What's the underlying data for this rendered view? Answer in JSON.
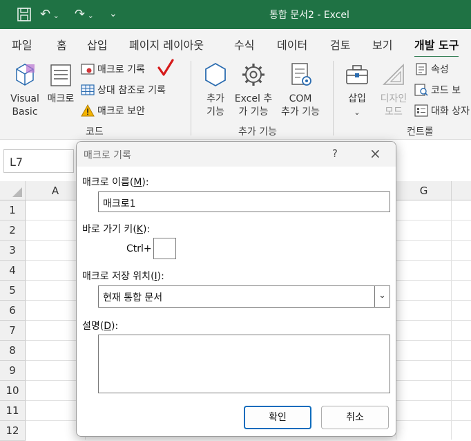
{
  "window": {
    "title": "통합 문서2 - Excel"
  },
  "ribbon_tabs": [
    "파일",
    "홈",
    "삽입",
    "페이지 레이아웃",
    "수식",
    "데이터",
    "검토",
    "보기",
    "개발 도구"
  ],
  "active_tab": "개발 도구",
  "ribbon": {
    "visual_basic": [
      "Visual",
      "Basic"
    ],
    "macros": "매크로",
    "record_macro": "매크로 기록",
    "relative_refs": "상대 참조로 기록",
    "macro_security": "매크로 보안",
    "group_code": "코드",
    "addins": [
      "추가",
      "기능"
    ],
    "excel_addins": [
      "Excel 추",
      "가 기능"
    ],
    "com_addins": [
      "COM",
      "추가 기능"
    ],
    "group_addins": "추가 기능",
    "insert": "삽입",
    "design_mode": [
      "디자인",
      "모드"
    ],
    "properties": "속성",
    "view_code": "코드 보",
    "run_dialog": "대화 상자",
    "group_controls": "컨트롤"
  },
  "name_box": "L7",
  "columns": [
    "A",
    "G"
  ],
  "rows": [
    "1",
    "2",
    "3",
    "4",
    "5",
    "6",
    "7",
    "8",
    "9",
    "10",
    "11",
    "12"
  ],
  "dialog": {
    "title": "매크로 기록",
    "help": "?",
    "macro_name_label": "매크로 이름",
    "macro_name_key": "M",
    "macro_name_value": "매크로1",
    "shortcut_label": "바로 가기 키",
    "shortcut_key": "K",
    "ctrl": "Ctrl+",
    "store_label": "매크로 저장 위치",
    "store_key": "I",
    "store_value": "현재 통합 문서",
    "desc_label": "설명",
    "desc_key": "D",
    "ok": "확인",
    "cancel": "취소"
  },
  "colors": {
    "excel_green": "#1f7244",
    "checkmark": "#d61a1a",
    "accent_blue": "#0f6cbd"
  }
}
